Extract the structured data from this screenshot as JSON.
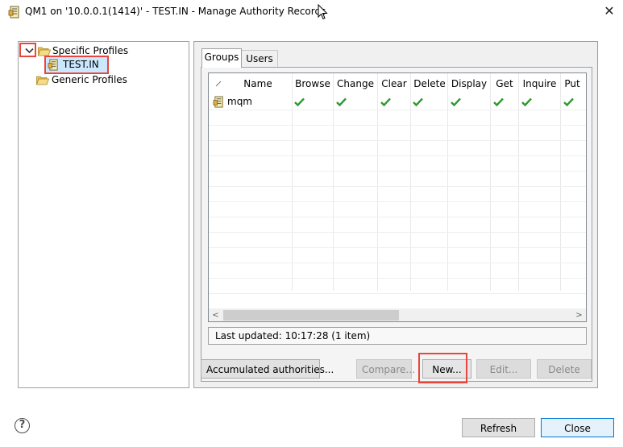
{
  "window": {
    "title": "QM1 on '10.0.0.1(1414)' - TEST.IN - Manage Authority Records",
    "close_glyph": "✕"
  },
  "tree": {
    "items": [
      {
        "label": "Specific Profiles",
        "expanded": true
      },
      {
        "label": "TEST.IN",
        "selected": true
      },
      {
        "label": "Generic Profiles"
      }
    ]
  },
  "tabs": [
    {
      "label": "Groups",
      "active": true
    },
    {
      "label": "Users",
      "active": false
    }
  ],
  "table": {
    "columns": [
      "Name",
      "Browse",
      "Change",
      "Clear",
      "Delete",
      "Display",
      "Get",
      "Inquire",
      "Put"
    ],
    "rows": [
      {
        "name": "mqm",
        "browse": true,
        "change": true,
        "clear": true,
        "delete": true,
        "display": true,
        "get": true,
        "inquire": true,
        "put": true
      }
    ]
  },
  "scrollbar": {
    "left_arrow": "<",
    "right_arrow": ">"
  },
  "status": {
    "text": "Last updated: 10:17:28 (1 item)"
  },
  "buttons": {
    "accumulated": "Accumulated authorities...",
    "compare": "Compare...",
    "new": "New...",
    "edit": "Edit...",
    "delete": "Delete",
    "refresh": "Refresh",
    "close": "Close",
    "help": "?"
  },
  "colors": {
    "highlight": "#e8453c",
    "selection": "#cce8ff",
    "check": "#2e9a2e"
  }
}
